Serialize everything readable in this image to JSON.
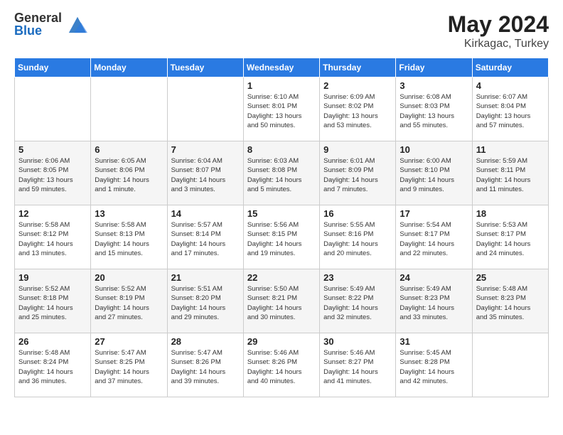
{
  "header": {
    "logo_general": "General",
    "logo_blue": "Blue",
    "title": "May 2024",
    "location": "Kirkagac, Turkey"
  },
  "days_of_week": [
    "Sunday",
    "Monday",
    "Tuesday",
    "Wednesday",
    "Thursday",
    "Friday",
    "Saturday"
  ],
  "weeks": [
    [
      {
        "day": "",
        "info": ""
      },
      {
        "day": "",
        "info": ""
      },
      {
        "day": "",
        "info": ""
      },
      {
        "day": "1",
        "info": "Sunrise: 6:10 AM\nSunset: 8:01 PM\nDaylight: 13 hours\nand 50 minutes."
      },
      {
        "day": "2",
        "info": "Sunrise: 6:09 AM\nSunset: 8:02 PM\nDaylight: 13 hours\nand 53 minutes."
      },
      {
        "day": "3",
        "info": "Sunrise: 6:08 AM\nSunset: 8:03 PM\nDaylight: 13 hours\nand 55 minutes."
      },
      {
        "day": "4",
        "info": "Sunrise: 6:07 AM\nSunset: 8:04 PM\nDaylight: 13 hours\nand 57 minutes."
      }
    ],
    [
      {
        "day": "5",
        "info": "Sunrise: 6:06 AM\nSunset: 8:05 PM\nDaylight: 13 hours\nand 59 minutes."
      },
      {
        "day": "6",
        "info": "Sunrise: 6:05 AM\nSunset: 8:06 PM\nDaylight: 14 hours\nand 1 minute."
      },
      {
        "day": "7",
        "info": "Sunrise: 6:04 AM\nSunset: 8:07 PM\nDaylight: 14 hours\nand 3 minutes."
      },
      {
        "day": "8",
        "info": "Sunrise: 6:03 AM\nSunset: 8:08 PM\nDaylight: 14 hours\nand 5 minutes."
      },
      {
        "day": "9",
        "info": "Sunrise: 6:01 AM\nSunset: 8:09 PM\nDaylight: 14 hours\nand 7 minutes."
      },
      {
        "day": "10",
        "info": "Sunrise: 6:00 AM\nSunset: 8:10 PM\nDaylight: 14 hours\nand 9 minutes."
      },
      {
        "day": "11",
        "info": "Sunrise: 5:59 AM\nSunset: 8:11 PM\nDaylight: 14 hours\nand 11 minutes."
      }
    ],
    [
      {
        "day": "12",
        "info": "Sunrise: 5:58 AM\nSunset: 8:12 PM\nDaylight: 14 hours\nand 13 minutes."
      },
      {
        "day": "13",
        "info": "Sunrise: 5:58 AM\nSunset: 8:13 PM\nDaylight: 14 hours\nand 15 minutes."
      },
      {
        "day": "14",
        "info": "Sunrise: 5:57 AM\nSunset: 8:14 PM\nDaylight: 14 hours\nand 17 minutes."
      },
      {
        "day": "15",
        "info": "Sunrise: 5:56 AM\nSunset: 8:15 PM\nDaylight: 14 hours\nand 19 minutes."
      },
      {
        "day": "16",
        "info": "Sunrise: 5:55 AM\nSunset: 8:16 PM\nDaylight: 14 hours\nand 20 minutes."
      },
      {
        "day": "17",
        "info": "Sunrise: 5:54 AM\nSunset: 8:17 PM\nDaylight: 14 hours\nand 22 minutes."
      },
      {
        "day": "18",
        "info": "Sunrise: 5:53 AM\nSunset: 8:17 PM\nDaylight: 14 hours\nand 24 minutes."
      }
    ],
    [
      {
        "day": "19",
        "info": "Sunrise: 5:52 AM\nSunset: 8:18 PM\nDaylight: 14 hours\nand 25 minutes."
      },
      {
        "day": "20",
        "info": "Sunrise: 5:52 AM\nSunset: 8:19 PM\nDaylight: 14 hours\nand 27 minutes."
      },
      {
        "day": "21",
        "info": "Sunrise: 5:51 AM\nSunset: 8:20 PM\nDaylight: 14 hours\nand 29 minutes."
      },
      {
        "day": "22",
        "info": "Sunrise: 5:50 AM\nSunset: 8:21 PM\nDaylight: 14 hours\nand 30 minutes."
      },
      {
        "day": "23",
        "info": "Sunrise: 5:49 AM\nSunset: 8:22 PM\nDaylight: 14 hours\nand 32 minutes."
      },
      {
        "day": "24",
        "info": "Sunrise: 5:49 AM\nSunset: 8:23 PM\nDaylight: 14 hours\nand 33 minutes."
      },
      {
        "day": "25",
        "info": "Sunrise: 5:48 AM\nSunset: 8:23 PM\nDaylight: 14 hours\nand 35 minutes."
      }
    ],
    [
      {
        "day": "26",
        "info": "Sunrise: 5:48 AM\nSunset: 8:24 PM\nDaylight: 14 hours\nand 36 minutes."
      },
      {
        "day": "27",
        "info": "Sunrise: 5:47 AM\nSunset: 8:25 PM\nDaylight: 14 hours\nand 37 minutes."
      },
      {
        "day": "28",
        "info": "Sunrise: 5:47 AM\nSunset: 8:26 PM\nDaylight: 14 hours\nand 39 minutes."
      },
      {
        "day": "29",
        "info": "Sunrise: 5:46 AM\nSunset: 8:26 PM\nDaylight: 14 hours\nand 40 minutes."
      },
      {
        "day": "30",
        "info": "Sunrise: 5:46 AM\nSunset: 8:27 PM\nDaylight: 14 hours\nand 41 minutes."
      },
      {
        "day": "31",
        "info": "Sunrise: 5:45 AM\nSunset: 8:28 PM\nDaylight: 14 hours\nand 42 minutes."
      },
      {
        "day": "",
        "info": ""
      }
    ]
  ]
}
